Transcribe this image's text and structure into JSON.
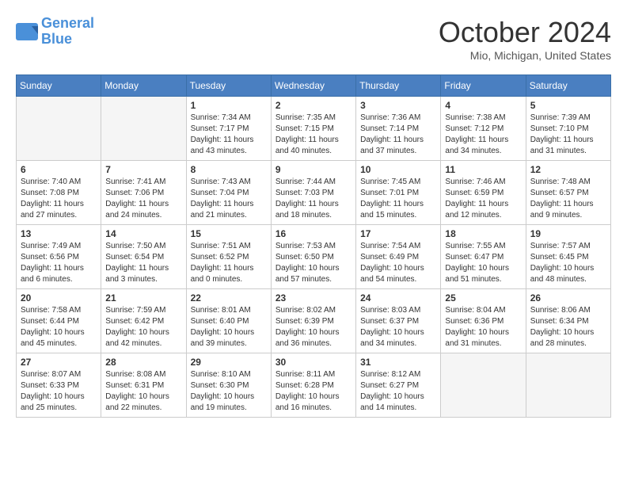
{
  "header": {
    "logo_line1": "General",
    "logo_line2": "Blue",
    "month": "October 2024",
    "location": "Mio, Michigan, United States"
  },
  "weekdays": [
    "Sunday",
    "Monday",
    "Tuesday",
    "Wednesday",
    "Thursday",
    "Friday",
    "Saturday"
  ],
  "weeks": [
    [
      {
        "day": "",
        "empty": true
      },
      {
        "day": "",
        "empty": true
      },
      {
        "day": "1",
        "sunrise": "7:34 AM",
        "sunset": "7:17 PM",
        "daylight": "11 hours and 43 minutes."
      },
      {
        "day": "2",
        "sunrise": "7:35 AM",
        "sunset": "7:15 PM",
        "daylight": "11 hours and 40 minutes."
      },
      {
        "day": "3",
        "sunrise": "7:36 AM",
        "sunset": "7:14 PM",
        "daylight": "11 hours and 37 minutes."
      },
      {
        "day": "4",
        "sunrise": "7:38 AM",
        "sunset": "7:12 PM",
        "daylight": "11 hours and 34 minutes."
      },
      {
        "day": "5",
        "sunrise": "7:39 AM",
        "sunset": "7:10 PM",
        "daylight": "11 hours and 31 minutes."
      }
    ],
    [
      {
        "day": "6",
        "sunrise": "7:40 AM",
        "sunset": "7:08 PM",
        "daylight": "11 hours and 27 minutes."
      },
      {
        "day": "7",
        "sunrise": "7:41 AM",
        "sunset": "7:06 PM",
        "daylight": "11 hours and 24 minutes."
      },
      {
        "day": "8",
        "sunrise": "7:43 AM",
        "sunset": "7:04 PM",
        "daylight": "11 hours and 21 minutes."
      },
      {
        "day": "9",
        "sunrise": "7:44 AM",
        "sunset": "7:03 PM",
        "daylight": "11 hours and 18 minutes."
      },
      {
        "day": "10",
        "sunrise": "7:45 AM",
        "sunset": "7:01 PM",
        "daylight": "11 hours and 15 minutes."
      },
      {
        "day": "11",
        "sunrise": "7:46 AM",
        "sunset": "6:59 PM",
        "daylight": "11 hours and 12 minutes."
      },
      {
        "day": "12",
        "sunrise": "7:48 AM",
        "sunset": "6:57 PM",
        "daylight": "11 hours and 9 minutes."
      }
    ],
    [
      {
        "day": "13",
        "sunrise": "7:49 AM",
        "sunset": "6:56 PM",
        "daylight": "11 hours and 6 minutes."
      },
      {
        "day": "14",
        "sunrise": "7:50 AM",
        "sunset": "6:54 PM",
        "daylight": "11 hours and 3 minutes."
      },
      {
        "day": "15",
        "sunrise": "7:51 AM",
        "sunset": "6:52 PM",
        "daylight": "11 hours and 0 minutes."
      },
      {
        "day": "16",
        "sunrise": "7:53 AM",
        "sunset": "6:50 PM",
        "daylight": "10 hours and 57 minutes."
      },
      {
        "day": "17",
        "sunrise": "7:54 AM",
        "sunset": "6:49 PM",
        "daylight": "10 hours and 54 minutes."
      },
      {
        "day": "18",
        "sunrise": "7:55 AM",
        "sunset": "6:47 PM",
        "daylight": "10 hours and 51 minutes."
      },
      {
        "day": "19",
        "sunrise": "7:57 AM",
        "sunset": "6:45 PM",
        "daylight": "10 hours and 48 minutes."
      }
    ],
    [
      {
        "day": "20",
        "sunrise": "7:58 AM",
        "sunset": "6:44 PM",
        "daylight": "10 hours and 45 minutes."
      },
      {
        "day": "21",
        "sunrise": "7:59 AM",
        "sunset": "6:42 PM",
        "daylight": "10 hours and 42 minutes."
      },
      {
        "day": "22",
        "sunrise": "8:01 AM",
        "sunset": "6:40 PM",
        "daylight": "10 hours and 39 minutes."
      },
      {
        "day": "23",
        "sunrise": "8:02 AM",
        "sunset": "6:39 PM",
        "daylight": "10 hours and 36 minutes."
      },
      {
        "day": "24",
        "sunrise": "8:03 AM",
        "sunset": "6:37 PM",
        "daylight": "10 hours and 34 minutes."
      },
      {
        "day": "25",
        "sunrise": "8:04 AM",
        "sunset": "6:36 PM",
        "daylight": "10 hours and 31 minutes."
      },
      {
        "day": "26",
        "sunrise": "8:06 AM",
        "sunset": "6:34 PM",
        "daylight": "10 hours and 28 minutes."
      }
    ],
    [
      {
        "day": "27",
        "sunrise": "8:07 AM",
        "sunset": "6:33 PM",
        "daylight": "10 hours and 25 minutes."
      },
      {
        "day": "28",
        "sunrise": "8:08 AM",
        "sunset": "6:31 PM",
        "daylight": "10 hours and 22 minutes."
      },
      {
        "day": "29",
        "sunrise": "8:10 AM",
        "sunset": "6:30 PM",
        "daylight": "10 hours and 19 minutes."
      },
      {
        "day": "30",
        "sunrise": "8:11 AM",
        "sunset": "6:28 PM",
        "daylight": "10 hours and 16 minutes."
      },
      {
        "day": "31",
        "sunrise": "8:12 AM",
        "sunset": "6:27 PM",
        "daylight": "10 hours and 14 minutes."
      },
      {
        "day": "",
        "empty": true
      },
      {
        "day": "",
        "empty": true
      }
    ]
  ]
}
